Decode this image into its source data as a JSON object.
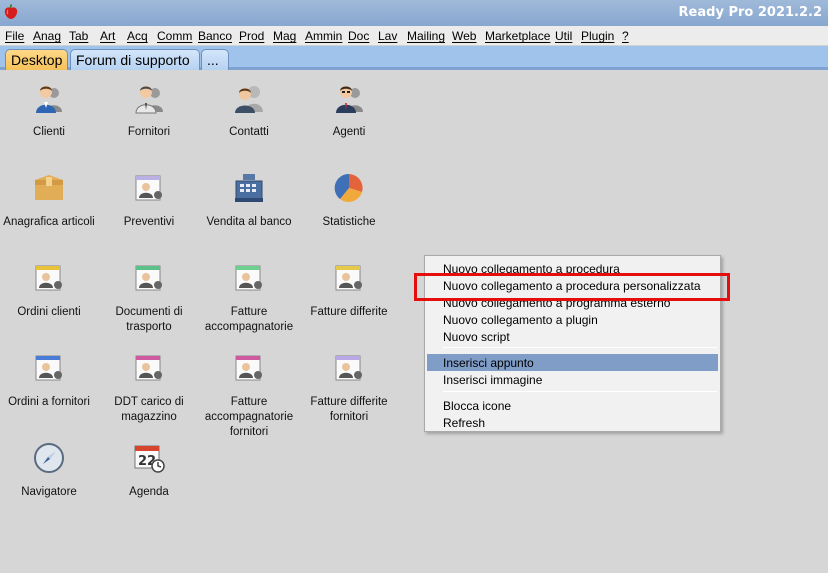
{
  "window": {
    "title": "Ready Pro 2021.2.2"
  },
  "menu": [
    "File",
    "Anag",
    "Tab",
    "Art",
    "Acq",
    "Comm",
    "Banco",
    "Prod",
    "Mag",
    "Ammin",
    "Doc",
    "Lav",
    "Mailing",
    "Web",
    "Marketplace",
    "Util",
    "Plugin",
    "?"
  ],
  "tabs": [
    "Desktop",
    "Forum di supporto",
    "..."
  ],
  "desktop_icons": [
    {
      "label": "Clienti",
      "icon": "clients-icon"
    },
    {
      "label": "Fornitori",
      "icon": "suppliers-icon"
    },
    {
      "label": "Contatti",
      "icon": "contacts-icon"
    },
    {
      "label": "Agenti",
      "icon": "agents-icon"
    },
    {
      "label": "Anagrafica articoli",
      "icon": "articles-box-icon"
    },
    {
      "label": "Preventivi",
      "icon": "quotes-icon"
    },
    {
      "label": "Vendita al banco",
      "icon": "cash-register-icon"
    },
    {
      "label": "Statistiche",
      "icon": "pie-chart-icon"
    },
    {
      "label": "Ordini clienti",
      "icon": "customer-orders-icon"
    },
    {
      "label": "Documenti di trasporto",
      "icon": "transport-documents-icon"
    },
    {
      "label": "Fatture accompagnatorie",
      "icon": "accompanying-invoices-icon"
    },
    {
      "label": "Fatture differite",
      "icon": "deferred-invoices-icon"
    },
    {
      "label": "Ordini a fornitori",
      "icon": "supplier-orders-icon"
    },
    {
      "label": "DDT carico di magazzino",
      "icon": "warehouse-ddt-icon"
    },
    {
      "label": "Fatture accompagnatorie fornitori",
      "icon": "supplier-accompanying-invoices-icon"
    },
    {
      "label": "Fatture differite fornitori",
      "icon": "supplier-deferred-invoices-icon"
    },
    {
      "label": "Navigatore",
      "icon": "compass-icon"
    },
    {
      "label": "Agenda",
      "icon": "calendar-clock-icon"
    }
  ],
  "context_menu": {
    "items": [
      "Nuovo collegamento a procedura",
      "Nuovo collegamento a procedura personalizzata",
      "Nuovo collegamento a programma esterno",
      "Nuovo collegamento a plugin",
      "Nuovo script",
      "Inserisci appunto",
      "Inserisci immagine",
      "Blocca icone",
      "Refresh"
    ],
    "highlighted": "Inserisci appunto"
  },
  "colors": {
    "title_bar": "#88a7cf",
    "tab_active": "#f6c15a",
    "menu_highlight": "#7f9dc7",
    "annotation_box": "#e60d0d"
  }
}
